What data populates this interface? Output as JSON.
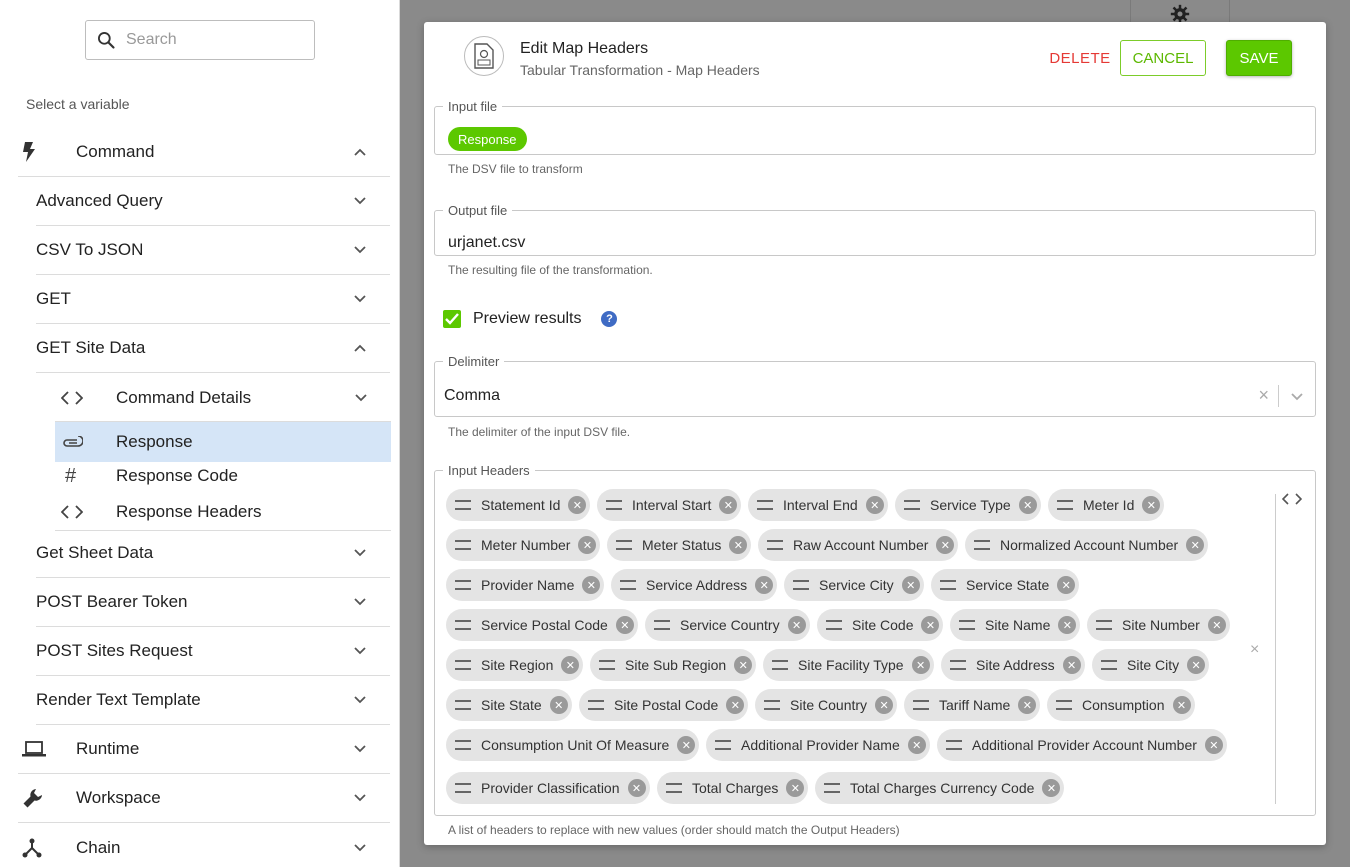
{
  "sidebar": {
    "search_placeholder": "Search",
    "select_label": "Select a variable",
    "command": {
      "label": "Command"
    },
    "commands": [
      {
        "label": "Advanced Query"
      },
      {
        "label": "CSV To JSON"
      },
      {
        "label": "GET"
      },
      {
        "label": "GET Site Data"
      }
    ],
    "get_site_data_children": [
      {
        "label": "Command Details"
      },
      {
        "label": "Response"
      },
      {
        "label": "Response Code",
        "icon": "#"
      },
      {
        "label": "Response Headers"
      }
    ],
    "more_commands": [
      {
        "label": "Get Sheet Data"
      },
      {
        "label": "POST Bearer Token"
      },
      {
        "label": "POST Sites Request"
      },
      {
        "label": "Render Text Template"
      }
    ],
    "runtime": {
      "label": "Runtime"
    },
    "workspace": {
      "label": "Workspace"
    },
    "chain": {
      "label": "Chain"
    }
  },
  "modal": {
    "title": "Edit Map Headers",
    "subtitle": "Tabular Transformation - Map Headers",
    "delete_label": "DELETE",
    "cancel_label": "CANCEL",
    "save_label": "SAVE",
    "input_file": {
      "label": "Input file",
      "value": "Response",
      "helper": "The DSV file to transform"
    },
    "output_file": {
      "label": "Output file",
      "value": "urjanet.csv",
      "helper": "The resulting file of the transformation."
    },
    "preview": {
      "label": "Preview results",
      "checked": true,
      "help": "?"
    },
    "delimiter": {
      "label": "Delimiter",
      "value": "Comma",
      "clear": "×",
      "helper": "The delimiter of the input DSV file."
    },
    "input_headers": {
      "label": "Input Headers",
      "clear": "×",
      "helper": "A list of headers to replace with new values (order should match the Output Headers)",
      "rows": [
        [
          "Statement Id",
          "Interval Start",
          "Interval End",
          "Service Type",
          "Meter Id"
        ],
        [
          "Meter Number",
          "Meter Status",
          "Raw Account Number",
          "Normalized Account Number"
        ],
        [
          "Provider Name",
          "Service Address",
          "Service City",
          "Service State"
        ],
        [
          "Service Postal Code",
          "Service Country",
          "Site Code",
          "Site Name",
          "Site Number"
        ],
        [
          "Site Region",
          "Site Sub Region",
          "Site Facility Type",
          "Site Address",
          "Site City"
        ],
        [
          "Site State",
          "Site Postal Code",
          "Site Country",
          "Tariff Name",
          "Consumption"
        ],
        [
          "Consumption Unit Of Measure",
          "Additional Provider Name",
          "Additional Provider Account Number"
        ],
        [
          "Provider Classification",
          "Total Charges",
          "Total Charges Currency Code"
        ]
      ]
    }
  },
  "colors": {
    "accent_green": "#5cc800",
    "delete_red": "#e53935",
    "selected_bg": "#d5e5f7",
    "help_blue": "#3f6bc4"
  }
}
